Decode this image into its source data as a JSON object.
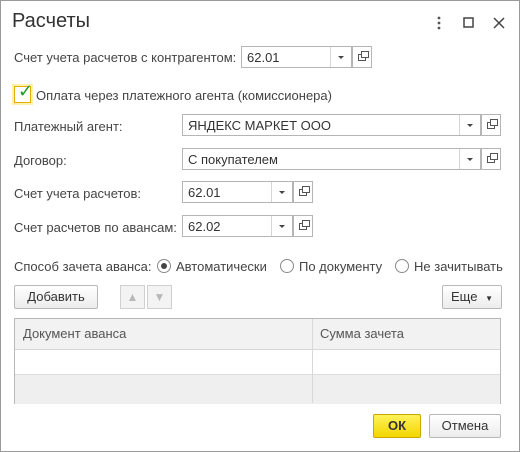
{
  "window": {
    "title": "Расчеты"
  },
  "fields": {
    "contractor_account_label": "Счет учета расчетов с контрагентом:",
    "contractor_account_value": "62.01",
    "agent_checkbox_label": "Оплата через платежного агента (комиссионера)",
    "agent_checkbox_checked": true,
    "agent_label": "Платежный агент:",
    "agent_value": "ЯНДЕКС МАРКЕТ ООО",
    "contract_label": "Договор:",
    "contract_value": "С покупателем",
    "settlement_account_label": "Счет учета расчетов:",
    "settlement_account_value": "62.01",
    "advance_account_label": "Счет расчетов по авансам:",
    "advance_account_value": "62.02"
  },
  "advance": {
    "label": "Способ зачета аванса:",
    "options": [
      "Автоматически",
      "По документу",
      "Не зачитывать"
    ],
    "selected": "Автоматически"
  },
  "toolbar": {
    "add_label": "Добавить",
    "more_label": "Еще"
  },
  "table": {
    "columns": [
      "Документ аванса",
      "Сумма зачета"
    ]
  },
  "footer": {
    "ok_label": "ОК",
    "cancel_label": "Отмена"
  }
}
